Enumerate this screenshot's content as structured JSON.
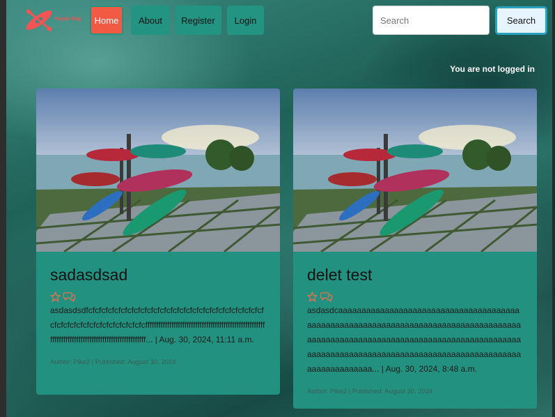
{
  "header": {
    "logo_text": "Kayak blog",
    "nav": {
      "home": "Home",
      "about": "About",
      "register": "Register",
      "login": "Login"
    },
    "search": {
      "placeholder": "Search",
      "button_label": "Search"
    }
  },
  "status": {
    "login_text": "You are not logged in"
  },
  "posts": [
    {
      "title": "sadasdsad",
      "excerpt": "asdasdsdfcfcfcfcfcfcfcfcfcfcfcfcfcfcfcfcfcfcfcfcfcfcfcfcfcfcfcfcfcfcfcfcfcfcfcfcfcfcfcfcfcfcfffffffffffffffffffffffffffffffffffffffffffffffffffffffffffffffffffffffffffffffffffffffffffffffffff...",
      "timestamp": "Aug. 30, 2024, 11:11 a.m.",
      "meta": "Author: Pike2 | Published: August 30, 2024",
      "icons": [
        "star-outline-icon",
        "comments-icon"
      ]
    },
    {
      "title": "delet test",
      "excerpt": "asdasdcaaaaaaaaaaaaaaaaaaaaaaaaaaaaaaaaaaaaaaaaaaaaaaaaaaaaaaaaaaaaaaaaaaaaaaaaaaaaaaaaaaaaaaaaaaaaaaaaaaaaaaaaaaaaaaaaaaaaaaaaaaaaaaaaaaaaaaaaaaaaaaaaaaaaaaaaaaaaaaaaaaaaaaaaaaaaaaaaaaaaaaaaaaaaaaa...",
      "timestamp": "Aug. 30, 2024, 8:48 a.m.",
      "meta": "Author: Pike2 | Published: August 30, 2024",
      "icons": [
        "star-outline-icon",
        "comments-icon"
      ]
    }
  ],
  "colors": {
    "nav_button": "#239482",
    "nav_active": "#f25a43",
    "card_background": "#23917f",
    "search_border": "#2aa0bf",
    "logo": "#f05454"
  }
}
